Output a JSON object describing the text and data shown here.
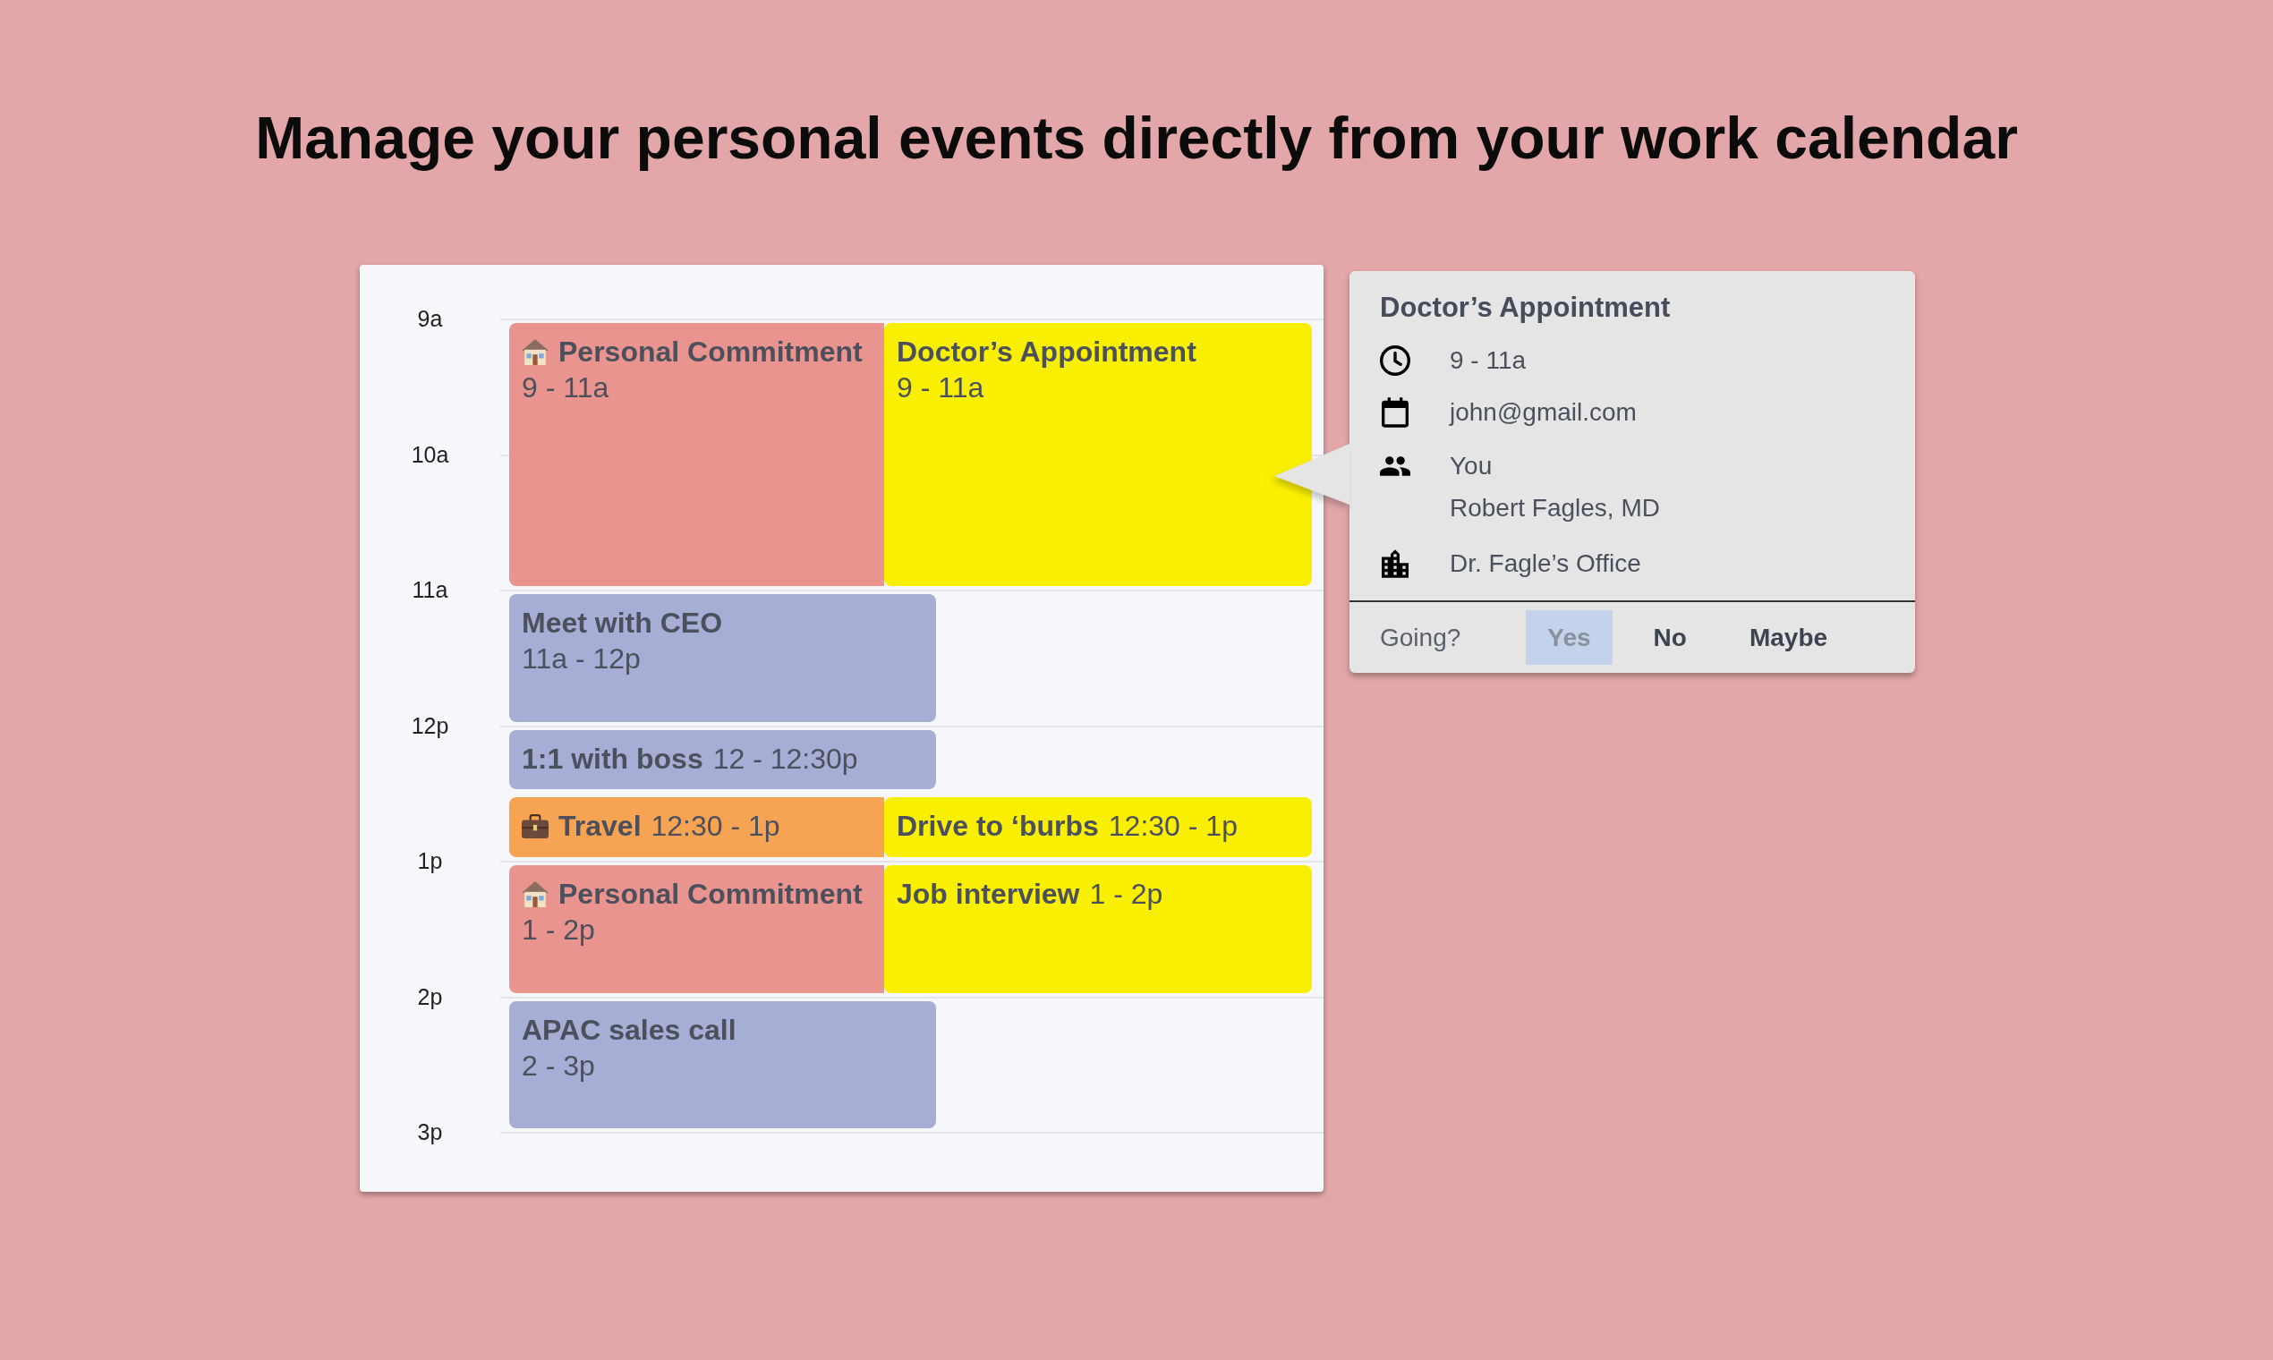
{
  "headline": "Manage your personal events directly from your work calendar",
  "calendar": {
    "hours": [
      "9a",
      "10a",
      "11a",
      "12p",
      "1p",
      "2p",
      "3p"
    ],
    "events": [
      {
        "kind": "personal",
        "title": "Personal Commitment",
        "time": "9 - 11a",
        "color": "#ea948f"
      },
      {
        "kind": "external",
        "title": "Doctor’s Appointment",
        "time": "9 - 11a",
        "color": "#f9ef00"
      },
      {
        "kind": "work",
        "title": "Meet with CEO",
        "time": "11a - 12p",
        "color": "#a7aed6"
      },
      {
        "kind": "work",
        "title": "1:1 with boss",
        "time": "12 - 12:30p",
        "color": "#a7aed6"
      },
      {
        "kind": "travel",
        "title": "Travel",
        "time": "12:30 - 1p",
        "color": "#f6a453"
      },
      {
        "kind": "external",
        "title": "Drive to ‘burbs",
        "time": "12:30 - 1p",
        "color": "#f9ef00"
      },
      {
        "kind": "personal",
        "title": "Personal Commitment",
        "time": "1 - 2p",
        "color": "#ea948f"
      },
      {
        "kind": "external",
        "title": "Job interview",
        "time": "1 - 2p",
        "color": "#f9ef00"
      },
      {
        "kind": "work",
        "title": "APAC sales call",
        "time": "2 - 3p",
        "color": "#a7aed6"
      }
    ]
  },
  "event_popup": {
    "title": "Doctor’s Appointment",
    "time": "9 - 11a",
    "calendar": "john@gmail.com",
    "guests": [
      "You",
      "Robert Fagles, MD"
    ],
    "location": "Dr. Fagle’s Office",
    "going_label": "Going?",
    "responses": [
      {
        "label": "Yes",
        "selected": true
      },
      {
        "label": "No",
        "selected": false
      },
      {
        "label": "Maybe",
        "selected": false
      }
    ]
  }
}
